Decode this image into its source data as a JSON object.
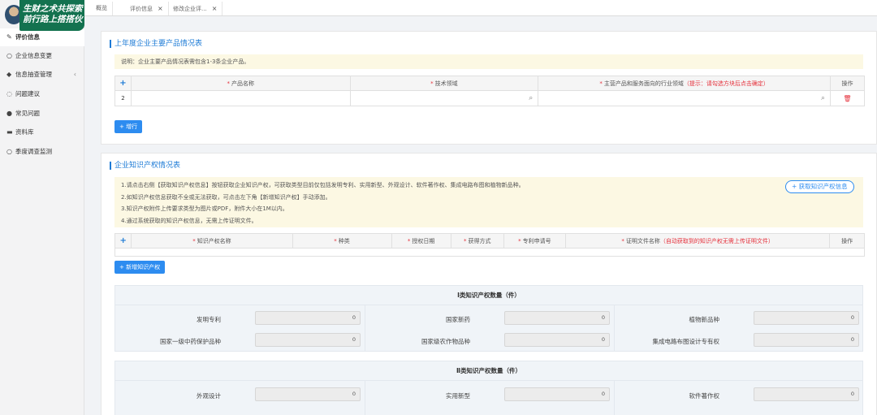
{
  "banner": {
    "line1": "生财之术共探索",
    "line2": "前行路上搭搭伙"
  },
  "tabs": [
    {
      "label": "概览",
      "closable": false
    },
    {
      "label": "评价信息",
      "closable": true
    },
    {
      "label": "修改企业评...",
      "closable": true
    }
  ],
  "sidebar": {
    "items": [
      {
        "label": "评价信息",
        "icon": "edit-icon",
        "glyph": "✎",
        "active": true,
        "submenu": false
      },
      {
        "label": "企业信息变更",
        "icon": "circle-icon",
        "glyph": "○",
        "active": false,
        "submenu": false
      },
      {
        "label": "信息抽查管理",
        "icon": "tag-icon",
        "glyph": "◆",
        "active": false,
        "submenu": true
      },
      {
        "label": "问题建议",
        "icon": "chat-icon",
        "glyph": "◌",
        "active": false,
        "submenu": false
      },
      {
        "label": "常见问题",
        "icon": "question-icon",
        "glyph": "●",
        "active": false,
        "submenu": false
      },
      {
        "label": "资料库",
        "icon": "folder-icon",
        "glyph": "▬",
        "active": false,
        "submenu": false
      },
      {
        "label": "季度调查监测",
        "icon": "circle-icon",
        "glyph": "○",
        "active": false,
        "submenu": false
      }
    ]
  },
  "products": {
    "title": "上年度企业主要产品情况表",
    "note": "说明：企业主要产品情况表需包含1-3条企业产品。",
    "columns": {
      "name": "产品名称",
      "tech": "技术领域",
      "industry": "主营产品和服务面向的行业领域",
      "industry_hint": "（提示：请勾选方块后点击确定）",
      "op": "操作"
    },
    "rows": [
      {
        "index": "2"
      }
    ],
    "add_button": "增行"
  },
  "ip": {
    "title": "企业知识产权情况表",
    "notes": [
      "1.请点击右侧【获取知识产权信息】按钮获取企业知识产权，可获取类型目前仅包括发明专利、实用新型、外观设计、软件著作权、集成电路布图和植物新品种。",
      "2.如知识产权信息获取不全或无法获取，可点击左下角【新增知识产权】手动添加。",
      "3.知识产权附件上传要求类型为图片或PDF，附件大小在1M以内。",
      "4.通过系统获取的知识产权信息，无需上传证明文件。"
    ],
    "fetch_button": "获取知识产权信息",
    "columns": {
      "name": "知识产权名称",
      "kind": "种类",
      "date": "授权日期",
      "method": "获得方式",
      "number": "专利申请号",
      "proof": "证明文件名称",
      "proof_hint": "（自动获取到的知识产权无需上传证明文件）",
      "op": "操作"
    },
    "add_button": "新增知识产权",
    "class1": {
      "title": "Ⅰ类知识产权数量（件）",
      "fields": [
        {
          "label": "发明专利",
          "value": "0"
        },
        {
          "label": "国家新药",
          "value": "0"
        },
        {
          "label": "植物新品种",
          "value": "0"
        },
        {
          "label": "国家一级中药保护品种",
          "value": "0"
        },
        {
          "label": "国家级农作物品种",
          "value": "0"
        },
        {
          "label": "集成电路布图设计专有权",
          "value": "0"
        }
      ]
    },
    "class2": {
      "title": "Ⅱ类知识产权数量（件）",
      "fields": [
        {
          "label": "外观设计",
          "value": "0"
        },
        {
          "label": "实用新型",
          "value": "0"
        },
        {
          "label": "软件著作权",
          "value": "0"
        }
      ]
    }
  }
}
